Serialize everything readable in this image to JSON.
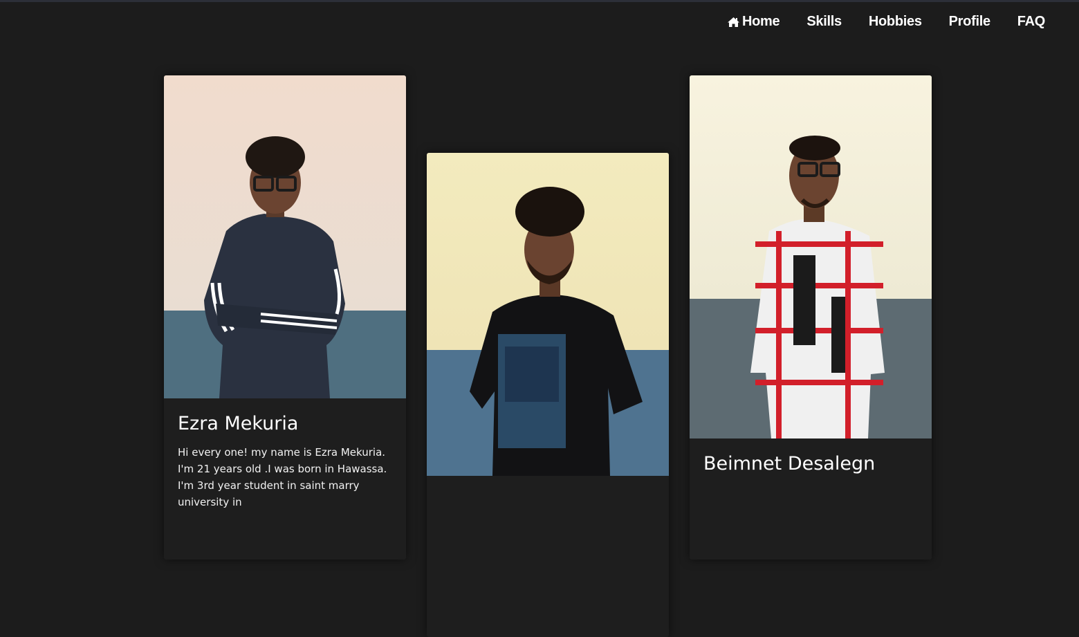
{
  "nav": {
    "items": [
      {
        "label": "Home",
        "icon": "home-icon"
      },
      {
        "label": "Skills"
      },
      {
        "label": "Hobbies"
      },
      {
        "label": "Profile"
      },
      {
        "label": "FAQ"
      }
    ]
  },
  "cards": [
    {
      "name": "Ezra Mekuria",
      "bio": "Hi every one! my name is Ezra Mekuria. I'm 21 years old .I was born in Hawassa. I'm 3rd year student in saint marry university in"
    },
    {
      "name": "",
      "bio": ""
    },
    {
      "name": "Beimnet Desalegn",
      "bio": ""
    }
  ],
  "colors": {
    "page_background": "#1c1c1c",
    "card_background": "#1e1e1e",
    "text": "#ffffff"
  }
}
